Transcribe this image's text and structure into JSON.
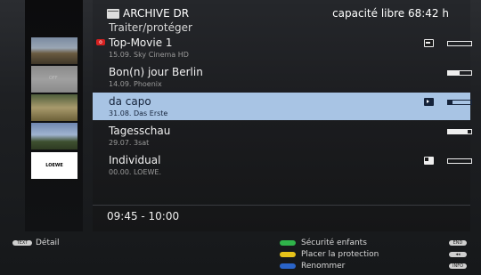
{
  "header": {
    "title": "ARCHIVE DR",
    "subtitle": "Traiter/protéger",
    "free_space": "capacité libre 68:42 h"
  },
  "thumbnails": {
    "t2_text": "OFF",
    "t5_logo": "LOEWE"
  },
  "recordings": [
    {
      "title": "Top-Movie 1",
      "meta": "15.09.   Sky Cinema HD",
      "locked": true,
      "status_icon": "key-icon",
      "progress": 0.0
    },
    {
      "title": "Bon(n) jour Berlin",
      "meta": "14.09.   Phoenix",
      "locked": false,
      "status_icon": "",
      "progress": 0.5
    },
    {
      "title": "da capo",
      "meta": "31.08.   Das Erste",
      "locked": false,
      "status_icon": "play-icon",
      "progress": 0.2,
      "selected": true
    },
    {
      "title": "Tagesschau",
      "meta": "29.07.   3sat",
      "locked": false,
      "status_icon": "",
      "progress": 0.85
    },
    {
      "title": "Individual",
      "meta": "00.00.   LOEWE.",
      "locked": false,
      "status_icon": "edit-icon",
      "progress": 0.0
    }
  ],
  "time_range": "09:45 - 10:00",
  "footer": {
    "text_key": "TEXT",
    "detail": "Détail",
    "green": "Sécurité enfants",
    "yellow": "Placer la protection",
    "blue": "Renommer",
    "end_key": "END",
    "rew_key": "◂◂",
    "info_key": "INFO"
  },
  "colors": {
    "selected_row": "#a8c4e4",
    "green": "#2fb34a",
    "yellow": "#e6c21a",
    "blue": "#2a64c8",
    "lock_badge": "#d62020"
  }
}
